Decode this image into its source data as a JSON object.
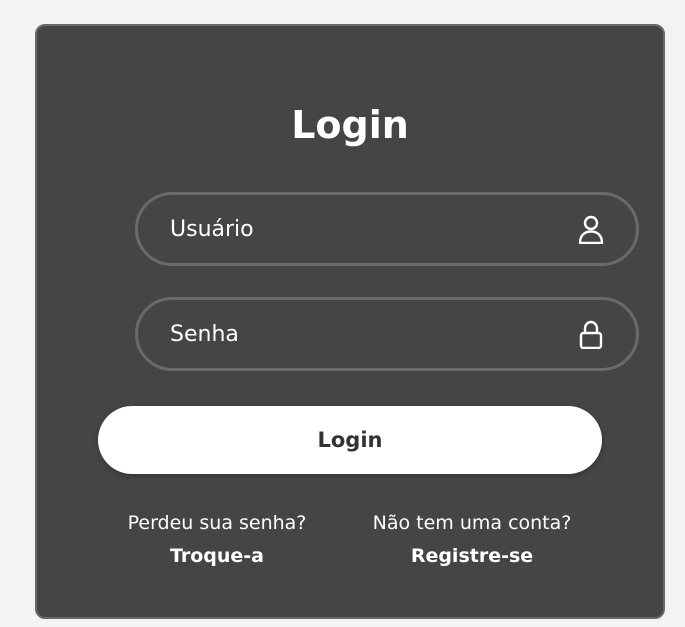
{
  "colors": {
    "page_bg": "#f3f3f3",
    "card_bg": "#464444",
    "text": "#ffffff",
    "button_bg": "#ffffff",
    "button_text": "#333333"
  },
  "form": {
    "title": "Login",
    "username": {
      "placeholder": "Usuário",
      "value": "",
      "icon": "user-icon"
    },
    "password": {
      "placeholder": "Senha",
      "value": "",
      "icon": "lock-icon"
    },
    "submit_label": "Login"
  },
  "links": {
    "forgot_prompt": "Perdeu sua senha?",
    "forgot_link": "Troque-a",
    "register_prompt": "Não tem uma conta?",
    "register_link": "Registre-se"
  }
}
